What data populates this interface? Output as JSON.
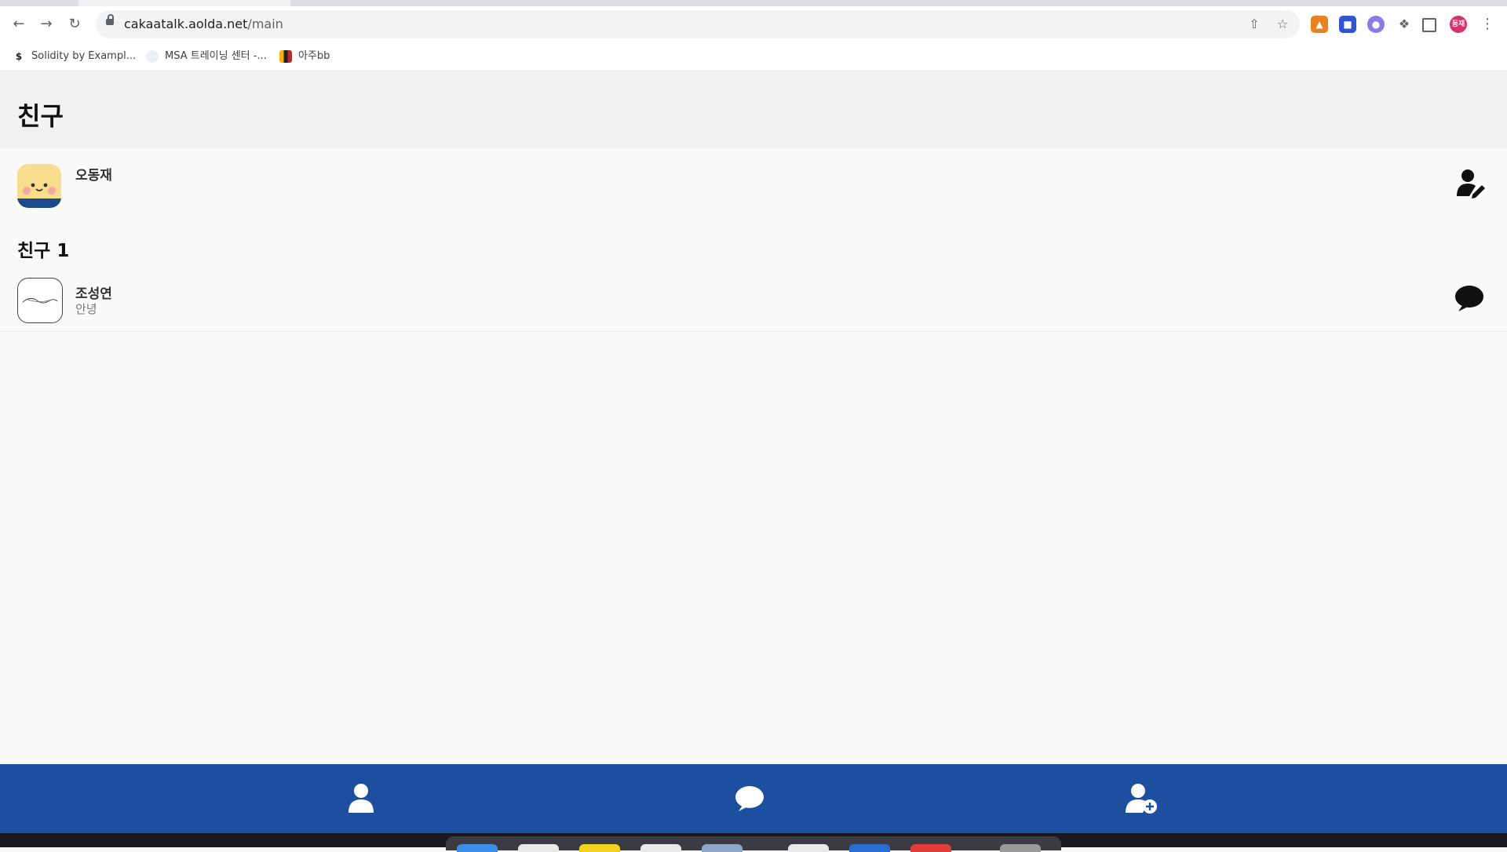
{
  "browser": {
    "url_host": "cakaatalk.aolda.net",
    "url_path": "/main",
    "profile_initials": "동재",
    "icons": [
      "back-icon",
      "forward-icon",
      "reload-icon",
      "lock-icon",
      "share-icon",
      "star-icon",
      "metamask-icon",
      "extension-icon",
      "phantom-icon",
      "puzzle-icon",
      "sidepanel-icon",
      "menu-icon"
    ],
    "bookmarks": [
      {
        "label": "Solidity by Exampl..."
      },
      {
        "label": "MSA 트레이닝 센터 -..."
      },
      {
        "label": "아주bb"
      }
    ]
  },
  "app": {
    "title": "친구",
    "me": {
      "name": "오동재"
    },
    "section_label": "친구 1",
    "friends": [
      {
        "name": "조성연",
        "status": "안녕"
      }
    ],
    "bottom_nav": [
      "friends-tab",
      "chat-tab",
      "add-friend-tab"
    ],
    "colors": {
      "bottom_nav": "#1d4fa0",
      "header_bg": "#f2f2f2"
    }
  }
}
